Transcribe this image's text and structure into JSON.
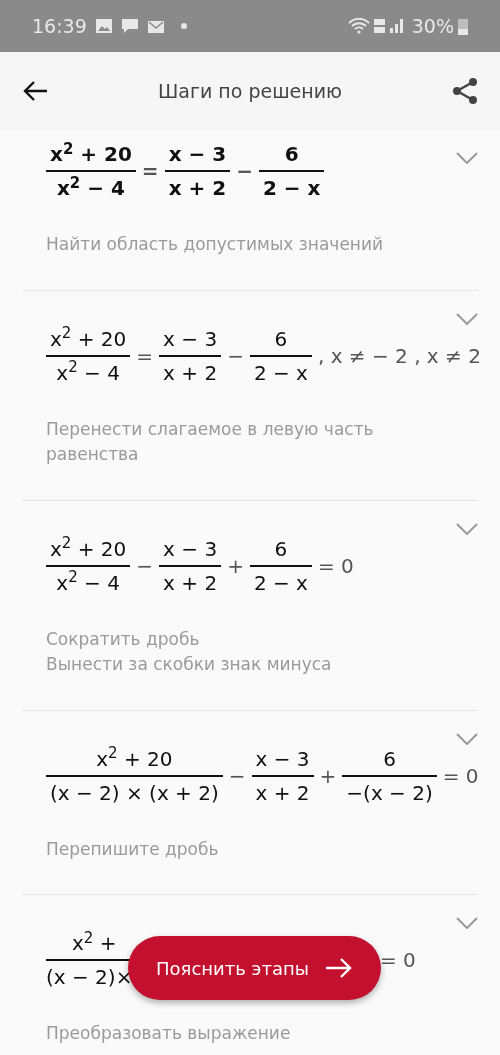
{
  "status_bar": {
    "time": "16:39",
    "battery": "30%"
  },
  "app_bar": {
    "title": "Шаги по решению"
  },
  "steps": [
    {
      "bold": true,
      "expression": [
        {
          "kind": "frac",
          "num": "x$^{2}$ + 20",
          "den": "x$^{2}$ − 4"
        },
        {
          "kind": "op",
          "text": "="
        },
        {
          "kind": "frac",
          "num": "x − 3",
          "den": "x + 2"
        },
        {
          "kind": "op",
          "text": "−"
        },
        {
          "kind": "frac",
          "num": "6",
          "den": "2 − x"
        }
      ],
      "description": [
        "Найти область допустимых значений"
      ]
    },
    {
      "bold": false,
      "expression": [
        {
          "kind": "frac",
          "num": "x$^{2}$ + 20",
          "den": "x$^{2}$ − 4"
        },
        {
          "kind": "op",
          "text": "="
        },
        {
          "kind": "frac",
          "num": "x − 3",
          "den": "x + 2"
        },
        {
          "kind": "op",
          "text": "−"
        },
        {
          "kind": "frac",
          "num": "6",
          "den": "2 − x"
        },
        {
          "kind": "op",
          "text": ", x ≠ − 2 , x ≠ 2"
        }
      ],
      "description": [
        "Перенести слагаемое в левую часть равенства"
      ]
    },
    {
      "bold": false,
      "expression": [
        {
          "kind": "frac",
          "num": "x$^{2}$ + 20",
          "den": "x$^{2}$ − 4"
        },
        {
          "kind": "op",
          "text": "−"
        },
        {
          "kind": "frac",
          "num": "x − 3",
          "den": "x + 2"
        },
        {
          "kind": "op",
          "text": "+"
        },
        {
          "kind": "frac",
          "num": "6",
          "den": "2 − x"
        },
        {
          "kind": "op",
          "text": "= 0"
        }
      ],
      "description": [
        "Сократить дробь",
        "Вынести за скобки знак минуса"
      ]
    },
    {
      "bold": false,
      "expression": [
        {
          "kind": "frac",
          "num": "x$^{2}$ + 20",
          "den": "(x − 2) × (x + 2)"
        },
        {
          "kind": "op",
          "text": "−"
        },
        {
          "kind": "frac",
          "num": "x − 3",
          "den": "x + 2"
        },
        {
          "kind": "op",
          "text": "+"
        },
        {
          "kind": "frac",
          "num": "6",
          "den": "−(x − 2)"
        },
        {
          "kind": "op",
          "text": "= 0"
        }
      ],
      "description": [
        "Перепишите дробь"
      ]
    },
    {
      "bold": false,
      "expression": [
        {
          "kind": "frac",
          "num": "x$^{2}$ +",
          "den": "(x − 2)×"
        },
        {
          "kind": "gap"
        },
        {
          "kind": "op",
          "text": "= 0"
        }
      ],
      "description": [
        "Преобразовать выражение"
      ]
    }
  ],
  "fab": {
    "label": "Пояснить этапы"
  }
}
